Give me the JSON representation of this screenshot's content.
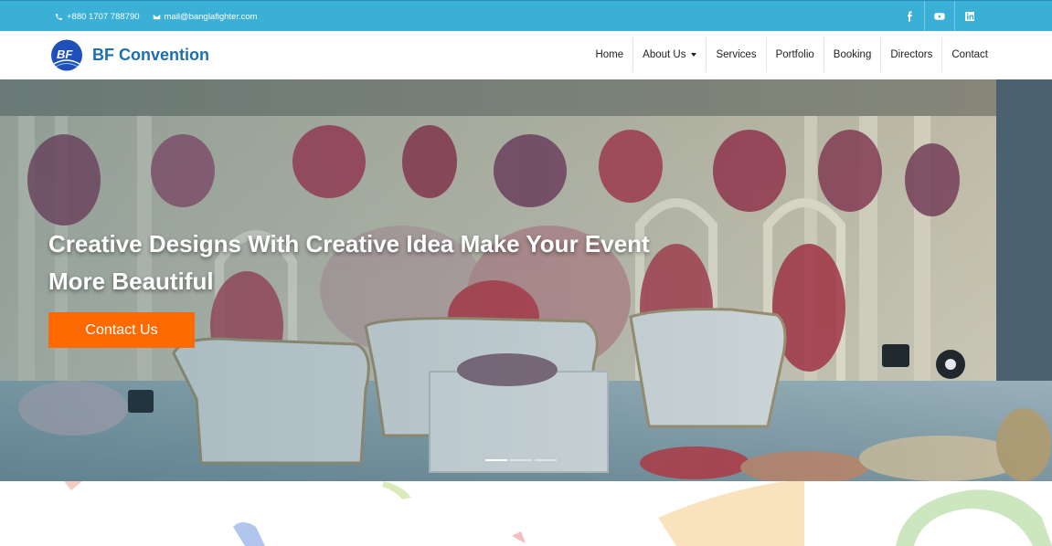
{
  "topbar": {
    "phone": "+880 1707 788790",
    "email": "mail@banglafighter.com",
    "social": [
      {
        "icon": "facebook-icon"
      },
      {
        "icon": "youtube-icon"
      },
      {
        "icon": "linkedin-icon"
      }
    ],
    "bg_color": "#3bb0d6"
  },
  "header": {
    "logo_text": "BF Convention",
    "logo_mark": "BF",
    "nav": [
      "Home",
      "About Us",
      "Services",
      "Portfolio",
      "Booking",
      "Directors",
      "Contact"
    ]
  },
  "hero": {
    "heading": "Creative Designs With Creative Idea Make Your Event More Beautiful",
    "cta_label": "Contact Us",
    "cta_color": "#ff6a00",
    "slide_count": 3,
    "active_slide": 1
  }
}
